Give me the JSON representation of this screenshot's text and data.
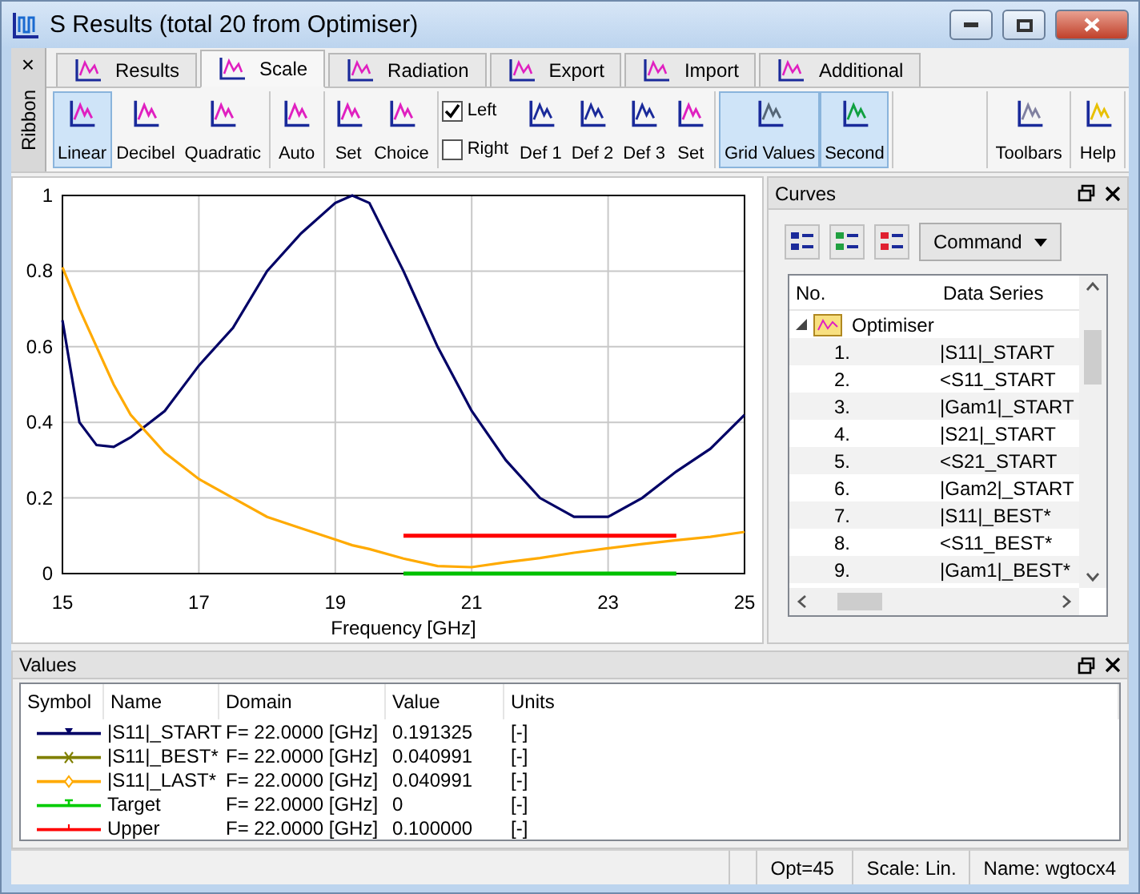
{
  "window": {
    "title": "S Results (total 20 from Optimiser)"
  },
  "ribbon": {
    "label": "Ribbon",
    "close": "×",
    "tabs": [
      {
        "label": "Results",
        "selected": false
      },
      {
        "label": "Scale",
        "selected": true
      },
      {
        "label": "Radiation",
        "selected": false
      },
      {
        "label": "Export",
        "selected": false
      },
      {
        "label": "Import",
        "selected": false
      },
      {
        "label": "Additional",
        "selected": false
      }
    ],
    "groups": [
      [
        {
          "kind": "button",
          "label": "Linear",
          "selected": true,
          "color": "#e020c0"
        },
        {
          "kind": "button",
          "label": "Decibel",
          "selected": false,
          "color": "#e020c0"
        },
        {
          "kind": "button",
          "label": "Quadratic",
          "selected": false,
          "color": "#e020c0"
        }
      ],
      [
        {
          "kind": "button",
          "label": "Auto",
          "selected": false,
          "color": "#e020c0"
        }
      ],
      [
        {
          "kind": "button",
          "label": "Set",
          "selected": false,
          "color": "#e020c0"
        },
        {
          "kind": "button",
          "label": "Choice",
          "selected": false,
          "color": "#e020c0"
        }
      ],
      [
        {
          "kind": "checks",
          "items": [
            {
              "label": "Left",
              "checked": true
            },
            {
              "label": "Right",
              "checked": false
            }
          ]
        },
        {
          "kind": "button",
          "label": "Def 1",
          "selected": false,
          "color": "#1a2a9a"
        },
        {
          "kind": "button",
          "label": "Def 2",
          "selected": false,
          "color": "#1a2a9a"
        },
        {
          "kind": "button",
          "label": "Def 3",
          "selected": false,
          "color": "#1a2a9a"
        },
        {
          "kind": "button",
          "label": "Set",
          "selected": false,
          "color": "#e020c0"
        }
      ],
      [
        {
          "kind": "button",
          "label": "Grid Values",
          "selected": true,
          "color": "#556677"
        },
        {
          "kind": "button",
          "label": "Second",
          "selected": true,
          "color": "#10a040"
        }
      ],
      [
        {
          "kind": "spacer"
        }
      ],
      [
        {
          "kind": "button",
          "label": "Toolbars",
          "selected": false,
          "color": "#8080a0"
        }
      ],
      [
        {
          "kind": "button",
          "label": "Help",
          "selected": false,
          "color": "#e8c000"
        }
      ]
    ]
  },
  "chart": {
    "chart_data": {
      "type": "line",
      "grid": true,
      "xlabel": "Frequency [GHz]",
      "xlim": [
        15,
        25
      ],
      "ylim": [
        0,
        1
      ],
      "xticks": [
        15,
        17,
        19,
        21,
        23,
        25
      ],
      "yticks": [
        0,
        0.2,
        0.4,
        0.6,
        0.8,
        {
          "value": 1,
          "label": "1"
        }
      ],
      "x": [
        15,
        15.25,
        15.5,
        15.75,
        16,
        16.5,
        17,
        17.5,
        18,
        18.5,
        19,
        19.25,
        19.5,
        20,
        20.5,
        21,
        21.5,
        22,
        22.5,
        23,
        23.5,
        24,
        24.5,
        25
      ],
      "series": [
        {
          "color": "#000066",
          "values": [
            0.67,
            0.4,
            0.34,
            0.335,
            0.36,
            0.43,
            0.55,
            0.65,
            0.8,
            0.9,
            0.98,
            1.0,
            0.98,
            0.8,
            0.6,
            0.43,
            0.3,
            0.2,
            0.15,
            0.15,
            0.2,
            0.27,
            0.33,
            0.42
          ]
        },
        {
          "color": "#ffaa00",
          "values": [
            0.81,
            0.7,
            0.6,
            0.5,
            0.42,
            0.32,
            0.25,
            0.2,
            0.15,
            0.12,
            0.09,
            0.075,
            0.065,
            0.04,
            0.02,
            0.017,
            0.03,
            0.041,
            0.055,
            0.067,
            0.078,
            0.088,
            0.097,
            0.11
          ]
        },
        {
          "color": "#00c000",
          "values": [
            null,
            null,
            null,
            null,
            null,
            null,
            null,
            null,
            null,
            null,
            null,
            null,
            null,
            0,
            0,
            0,
            0,
            0,
            0,
            0,
            0,
            0,
            null,
            null
          ]
        },
        {
          "color": "#ff0000",
          "values": [
            null,
            null,
            null,
            null,
            null,
            null,
            null,
            null,
            null,
            null,
            null,
            null,
            null,
            0.1,
            0.1,
            0.1,
            0.1,
            0.1,
            0.1,
            0.1,
            0.1,
            0.1,
            null,
            null
          ]
        }
      ]
    }
  },
  "curves": {
    "title": "Curves",
    "command": "Command",
    "columns": [
      "No.",
      "Data Series"
    ],
    "group": {
      "label": "Optimiser",
      "expanded": true,
      "children": [
        {
          "no": "1.",
          "series": "|S11|_START"
        },
        {
          "no": "2.",
          "series": "<S11_START"
        },
        {
          "no": "3.",
          "series": "|Gam1|_START"
        },
        {
          "no": "4.",
          "series": "|S21|_START"
        },
        {
          "no": "5.",
          "series": "<S21_START"
        },
        {
          "no": "6.",
          "series": "|Gam2|_START"
        },
        {
          "no": "7.",
          "series": "|S11|_BEST*"
        },
        {
          "no": "8.",
          "series": "<S11_BEST*"
        },
        {
          "no": "9.",
          "series": "|Gam1|_BEST*"
        }
      ]
    }
  },
  "values": {
    "title": "Values",
    "columns": [
      "Symbol",
      "Name",
      "Domain",
      "Value",
      "Units"
    ],
    "rows": [
      {
        "color": "#000066",
        "kind": "triangle",
        "name": "|S11|_START",
        "domain": "F= 22.0000 [GHz]",
        "value": "0.191325",
        "units": "[-]"
      },
      {
        "color": "#808000",
        "kind": "cross",
        "name": "|S11|_BEST*",
        "domain": "F= 22.0000 [GHz]",
        "value": "0.040991",
        "units": "[-]"
      },
      {
        "color": "#ffaa00",
        "kind": "diamond",
        "name": "|S11|_LAST*",
        "domain": "F= 22.0000 [GHz]",
        "value": "0.040991",
        "units": "[-]"
      },
      {
        "color": "#00cc00",
        "kind": "tee",
        "name": "Target",
        "domain": "F= 22.0000 [GHz]",
        "value": "0",
        "units": "[-]"
      },
      {
        "color": "#ff0000",
        "kind": "tick",
        "name": "Upper",
        "domain": "F= 22.0000 [GHz]",
        "value": "0.100000",
        "units": "[-]"
      }
    ]
  },
  "status_bar": [
    "Opt=45",
    "Scale: Lin.",
    "Name: wgtocx4"
  ]
}
